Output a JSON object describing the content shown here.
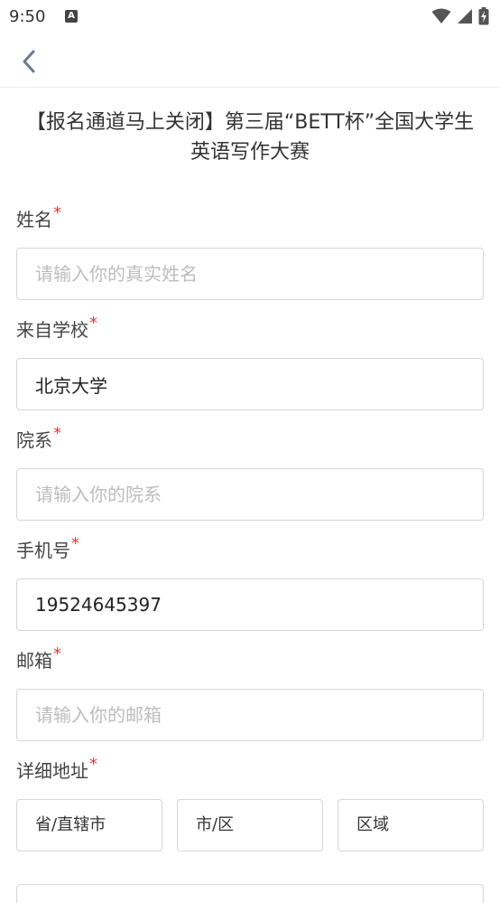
{
  "status": {
    "time": "9:50",
    "app_badge": "A"
  },
  "title": "【报名通道马上关闭】第三届“BETT杯”全国大学生英语写作大赛",
  "required_mark": "*",
  "fields": {
    "name": {
      "label": "姓名",
      "value": "",
      "placeholder": "请输入你的真实姓名"
    },
    "school": {
      "label": "来自学校",
      "value": "北京大学",
      "placeholder": ""
    },
    "department": {
      "label": "院系",
      "value": "",
      "placeholder": "请输入你的院系"
    },
    "phone": {
      "label": "手机号",
      "value": "19524645397",
      "placeholder": ""
    },
    "email": {
      "label": "邮箱",
      "value": "",
      "placeholder": "请输入你的邮箱"
    },
    "address": {
      "label": "详细地址",
      "province": "省/直辖市",
      "city": "市/区",
      "district": "区域"
    }
  }
}
